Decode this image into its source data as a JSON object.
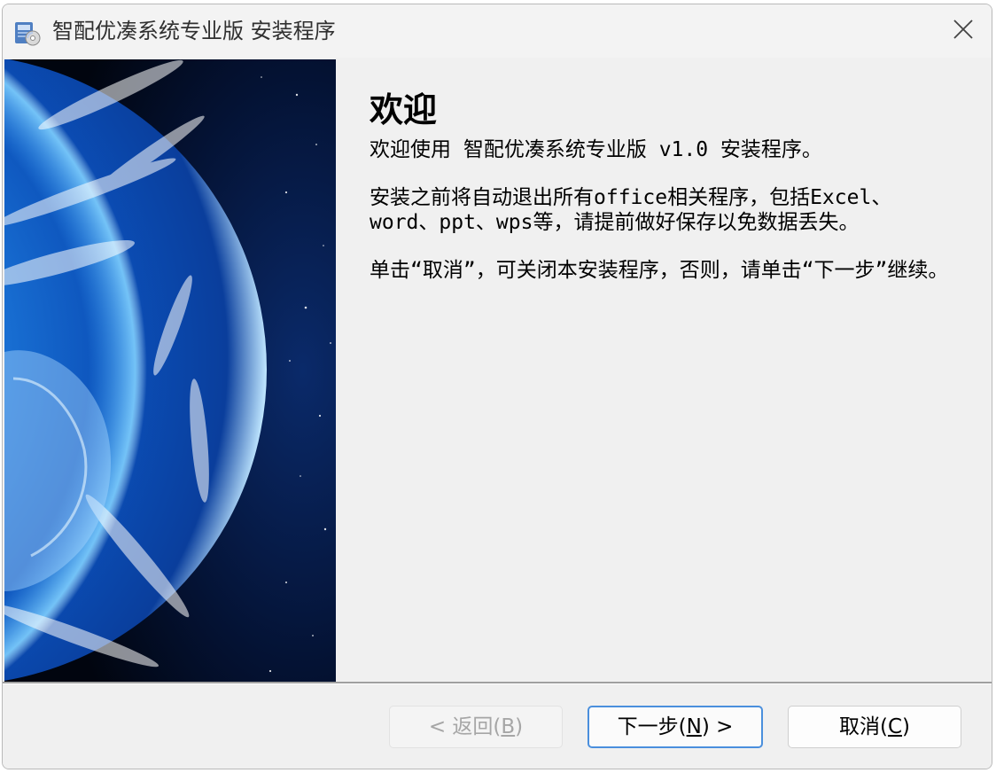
{
  "window": {
    "title": "智配优凑系统专业版 安装程序",
    "icon": "installer-icon",
    "close_icon": "close-icon"
  },
  "banner": {
    "image": "earth-from-space"
  },
  "content": {
    "heading": "欢迎",
    "paragraphs": [
      "欢迎使用 智配优凑系统专业版 v1.0 安装程序。",
      "安装之前将自动退出所有office相关程序，包括Excel、word、ppt、wps等，请提前做好保存以免数据丢失。",
      "单击“取消”，可关闭本安装程序，否则，请单击“下一步”继续。"
    ]
  },
  "buttons": {
    "back": {
      "prefix": "< 返回(",
      "key": "B",
      "suffix": ")",
      "enabled": false
    },
    "next": {
      "prefix": "下一步(",
      "key": "N",
      "suffix": ") >",
      "enabled": true
    },
    "cancel": {
      "prefix": "取消(",
      "key": "C",
      "suffix": ")",
      "enabled": true
    }
  },
  "colors": {
    "window_bg": "#f0f0f0",
    "accent_border": "#4a8fdd",
    "disabled_text": "#a6a6a6"
  }
}
